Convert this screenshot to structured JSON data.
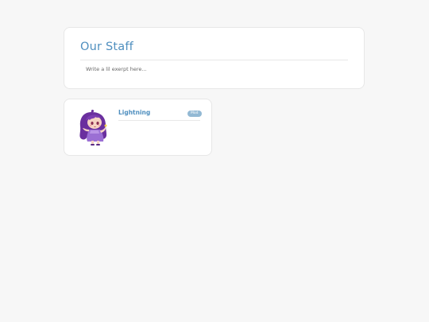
{
  "header": {
    "title": "Our Staff",
    "excerpt": "Write a lil exerpt here..."
  },
  "staff": [
    {
      "name": "Lightning",
      "role": "Mod",
      "avatar": "anime-character-purple-hair"
    }
  ],
  "colors": {
    "accent": "#4f8fbf",
    "badge": "#93b9d4",
    "background": "#f7f7f7",
    "card": "#ffffff"
  }
}
